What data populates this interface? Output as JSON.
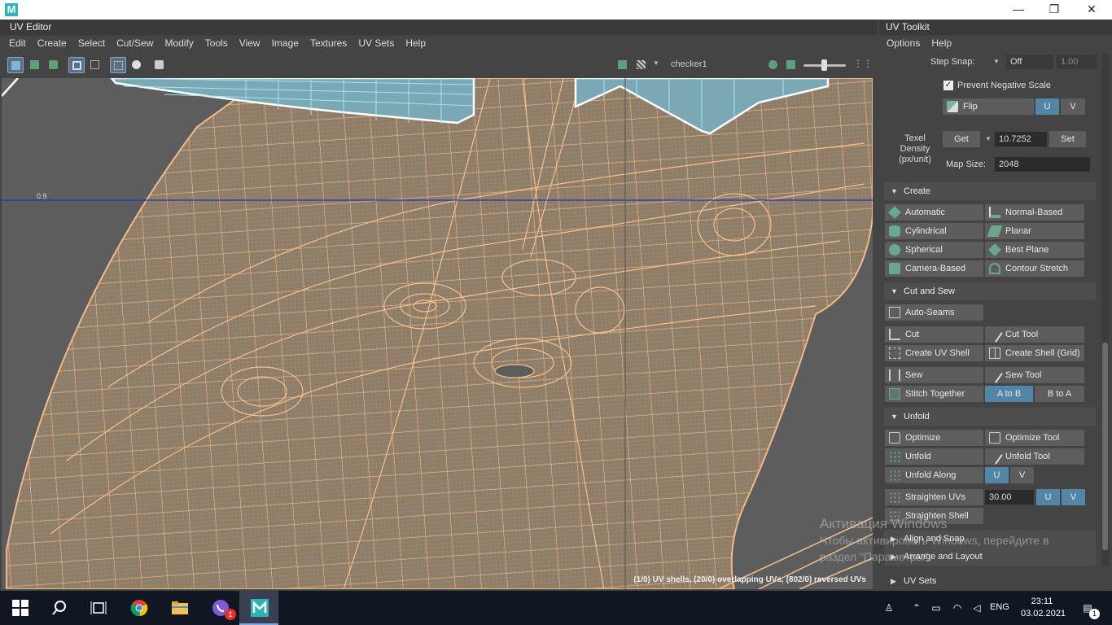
{
  "window": {
    "minimize": "—",
    "maximize": "❐",
    "close": "✕",
    "logo": "M"
  },
  "uv_editor": {
    "title": "UV Editor",
    "menu": [
      "Edit",
      "Create",
      "Select",
      "Cut/Sew",
      "Modify",
      "Tools",
      "View",
      "Image",
      "Textures",
      "UV Sets",
      "Help"
    ],
    "texture_name": "checker1",
    "axis_label": "0.9",
    "status": "(1/0) UV shells, (20/0) overlapping UVs, (802/0) reversed UVs"
  },
  "toolkit": {
    "title": "UV Toolkit",
    "menu": [
      "Options",
      "Help"
    ],
    "step_snap": {
      "label": "Step Snap:",
      "mode": "Off",
      "value": "1.00"
    },
    "prevent_negative_scale": {
      "label": "Prevent Negative Scale",
      "checked": true,
      "mark": "✓"
    },
    "flip": {
      "label": "Flip",
      "u": "U",
      "v": "V"
    },
    "texel_density": {
      "label_line1": "Texel",
      "label_line2": "Density",
      "label_line3": "(px/unit)",
      "get": "Get",
      "value": "10.7252",
      "set": "Set",
      "map_size_label": "Map Size:",
      "map_size": "2048"
    },
    "sections": {
      "create": {
        "title": "Create",
        "buttons": [
          "Automatic",
          "Normal-Based",
          "Cylindrical",
          "Planar",
          "Spherical",
          "Best Plane",
          "Camera-Based",
          "Contour Stretch"
        ]
      },
      "cut_and_sew": {
        "title": "Cut and Sew",
        "auto_seams": "Auto-Seams",
        "cut": "Cut",
        "cut_tool": "Cut Tool",
        "create_uv_shell": "Create UV Shell",
        "create_shell_grid": "Create Shell (Grid)",
        "sew": "Sew",
        "sew_tool": "Sew Tool",
        "stitch_together": "Stitch Together",
        "a_to_b": "A to B",
        "b_to_a": "B to A"
      },
      "unfold": {
        "title": "Unfold",
        "optimize": "Optimize",
        "optimize_tool": "Optimize Tool",
        "unfold": "Unfold",
        "unfold_tool": "Unfold Tool",
        "unfold_along": "Unfold Along",
        "u": "U",
        "v": "V",
        "straighten_uvs": "Straighten UVs",
        "straighten_angle": "30.00",
        "straighten_shell": "Straighten Shell"
      },
      "align_and_snap": {
        "title": "Align and Snap"
      },
      "arrange_and_layout": {
        "title": "Arrange and Layout"
      },
      "uv_sets": {
        "title": "UV Sets"
      }
    }
  },
  "watermark": {
    "line1": "Активация Windows",
    "line2": "Чтобы активировать Windows, перейдите в",
    "line3": "раздел \"Параметры\"."
  },
  "taskbar": {
    "language": "ENG",
    "time": "23:11",
    "date": "03.02.2021",
    "notification_count": "1",
    "viber_badge": "1"
  }
}
